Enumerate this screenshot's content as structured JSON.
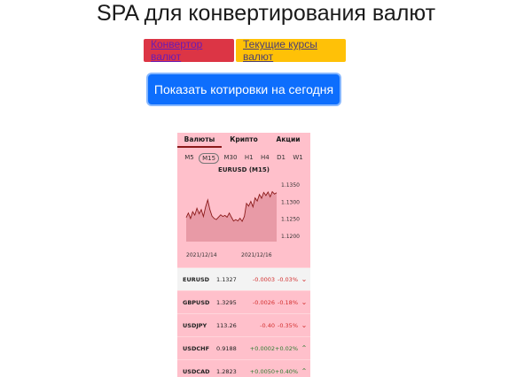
{
  "page": {
    "title": "SPA для конвертирования валют"
  },
  "nav": {
    "converter_label": "Конвертор валют",
    "rates_label": "Текущие курсы валют"
  },
  "actions": {
    "show_quotes_label": "Показать котировки на сегодня"
  },
  "colors": {
    "nav_converter": "#dc3545",
    "nav_rates": "#ffc107",
    "primary": "#0d6efd",
    "widget_bg": "#ffc0cb",
    "negative": "#d32f2f",
    "positive": "#2e7d32"
  },
  "widget": {
    "tabs": [
      {
        "label": "Валюты",
        "active": true
      },
      {
        "label": "Крипто",
        "active": false
      },
      {
        "label": "Акции",
        "active": false
      }
    ],
    "timeframes": [
      {
        "label": "M5",
        "active": false
      },
      {
        "label": "M15",
        "active": true
      },
      {
        "label": "M30",
        "active": false
      },
      {
        "label": "H1",
        "active": false
      },
      {
        "label": "H4",
        "active": false
      },
      {
        "label": "D1",
        "active": false
      },
      {
        "label": "W1",
        "active": false
      }
    ],
    "quotes": [
      {
        "symbol": "EURUSD",
        "price": "1.1327",
        "change": "-0.0003",
        "percent": "-0.03%",
        "direction": "down"
      },
      {
        "symbol": "GBPUSD",
        "price": "1.3295",
        "change": "-0.0026",
        "percent": "-0.18%",
        "direction": "down"
      },
      {
        "symbol": "USDJPY",
        "price": "113.26",
        "change": "-0.40",
        "percent": "-0.35%",
        "direction": "down"
      },
      {
        "symbol": "USDCHF",
        "price": "0.9188",
        "change": "+0.0002",
        "percent": "+0.02%",
        "direction": "up"
      },
      {
        "symbol": "USDCAD",
        "price": "1.2823",
        "change": "+0.0050",
        "percent": "+0.40%",
        "direction": "up"
      }
    ]
  },
  "chart_data": {
    "type": "area",
    "title": "EURUSD (M15)",
    "xlabel": "",
    "ylabel": "",
    "x_ticks": [
      "2021/12/14",
      "2021/12/16"
    ],
    "y_ticks": [
      "1.1350",
      "1.1300",
      "1.1250",
      "1.1200"
    ],
    "ylim": [
      1.1185,
      1.1365
    ],
    "grid": false,
    "series": [
      {
        "values": [
          1.1255,
          1.1268,
          1.1252,
          1.1272,
          1.1262,
          1.1282,
          1.1266,
          1.1278,
          1.1258,
          1.1286,
          1.1306,
          1.1278,
          1.1259,
          1.1252,
          1.1249,
          1.1256,
          1.1263,
          1.1258,
          1.1261,
          1.1256,
          1.1268,
          1.1256,
          1.1245,
          1.1249,
          1.1245,
          1.1253,
          1.1244,
          1.1258,
          1.1296,
          1.1288,
          1.1302,
          1.1286,
          1.1312,
          1.1303,
          1.1322,
          1.1311,
          1.1328,
          1.1319,
          1.1329,
          1.1315,
          1.133,
          1.1323,
          1.1327
        ]
      }
    ]
  }
}
